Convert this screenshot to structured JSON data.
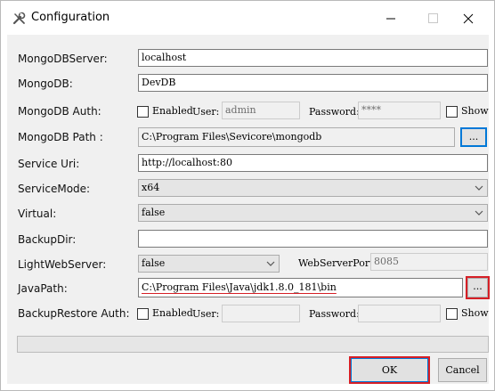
{
  "window": {
    "title": "Configuration",
    "icon": "tools-icon",
    "controls": [
      "minimize-icon",
      "maximize-icon",
      "close-icon"
    ]
  },
  "fields": {
    "mongodb_server": {
      "label": "MongoDBServer:",
      "value": "localhost"
    },
    "mongodb": {
      "label": "MongoDB:",
      "value": "DevDB"
    },
    "mongodb_auth": {
      "label": "MongoDB Auth:",
      "enabled_label": "Enabled",
      "enabled": false,
      "user_label": "User:",
      "user_value": "admin",
      "password_label": "Password:",
      "password_value": "****",
      "show_label": "Show",
      "show": false
    },
    "mongodb_path": {
      "label": "MongoDB Path :",
      "value": "C:\\Program Files\\Sevicore\\mongodb",
      "browse_label": "..."
    },
    "service_uri": {
      "label": "Service Uri:",
      "value": "http://localhost:80"
    },
    "service_mode": {
      "label": "ServiceMode:",
      "value": "x64"
    },
    "virtual": {
      "label": "Virtual:",
      "value": "false"
    },
    "backup_dir": {
      "label": "BackupDir:",
      "value": ""
    },
    "light_web_server": {
      "label": "LightWebServer:",
      "value": "false",
      "port_label": "WebServerPort:",
      "port_value": "8085"
    },
    "java_path": {
      "label": "JavaPath:",
      "value": "C:\\Program Files\\Java\\jdk1.8.0_181\\bin",
      "browse_label": "..."
    },
    "backup_restore_auth": {
      "label": "BackupRestore Auth:",
      "enabled_label": "Enabled",
      "enabled": false,
      "user_label": "User:",
      "user_value": "",
      "password_label": "Password:",
      "password_value": "",
      "show_label": "Show",
      "show": false
    }
  },
  "progress": {
    "value": 0
  },
  "buttons": {
    "ok": "OK",
    "cancel": "Cancel"
  },
  "colors": {
    "highlight": "#d61f26",
    "focus_blue": "#0078d7",
    "dialog_bg": "#f0f0f0"
  }
}
